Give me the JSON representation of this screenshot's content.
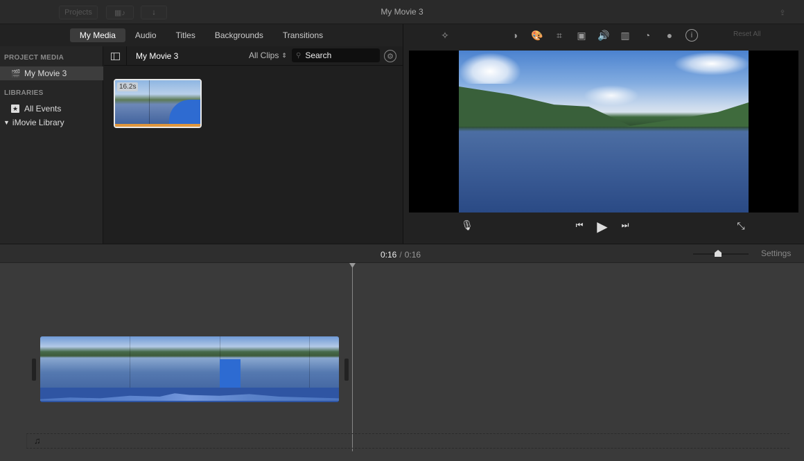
{
  "window": {
    "title": "My Movie 3"
  },
  "titlebar": {
    "projects_label": "Projects",
    "import_icon": "download-arrow-icon",
    "media_toggle_icon": "film-music-icon",
    "share_icon": "share-icon"
  },
  "media_tabs": [
    {
      "label": "My Media",
      "active": true
    },
    {
      "label": "Audio",
      "active": false
    },
    {
      "label": "Titles",
      "active": false
    },
    {
      "label": "Backgrounds",
      "active": false
    },
    {
      "label": "Transitions",
      "active": false
    }
  ],
  "sidebar": {
    "project_media_header": "PROJECT MEDIA",
    "project_item": "My Movie 3",
    "libraries_header": "LIBRARIES",
    "all_events": "All Events",
    "library": "iMovie Library"
  },
  "browser": {
    "title": "My Movie 3",
    "filter": "All Clips",
    "search_placeholder": "Search",
    "clips": [
      {
        "duration": "16.2s"
      }
    ]
  },
  "adjust_toolbar": {
    "icons": [
      "magic-wand-icon",
      "color-balance-icon",
      "color-correction-icon",
      "crop-icon",
      "stabilization-icon",
      "volume-icon",
      "noise-reduction-icon",
      "speed-icon",
      "clip-filter-icon",
      "info-icon"
    ],
    "reset_label": "Reset All"
  },
  "playback": {
    "current_time": "0:16",
    "separator": "/",
    "total_time": "0:16"
  },
  "timeline": {
    "settings_label": "Settings",
    "zoom_level": 0.45
  }
}
